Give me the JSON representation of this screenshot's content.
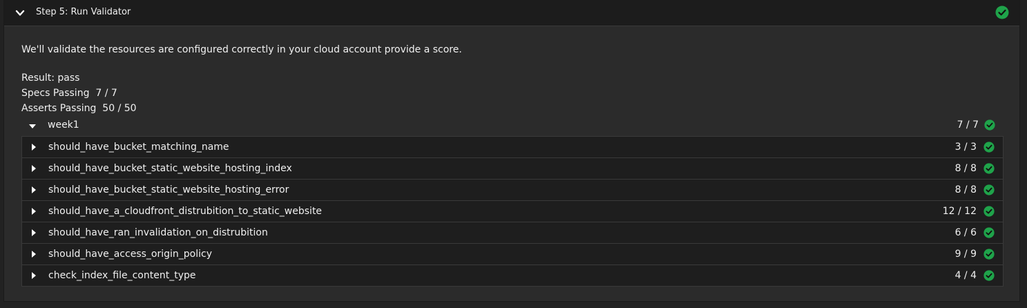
{
  "step": {
    "title": "Step 5: Run Validator",
    "status": "passed"
  },
  "description": "We'll validate the resources are configured correctly in your cloud account provide a score.",
  "summary": {
    "result": "Result: pass",
    "specs": "Specs Passing  7 / 7",
    "asserts": "Asserts Passing  50 / 50"
  },
  "group": {
    "name": "week1",
    "count": "7 / 7"
  },
  "specs": [
    {
      "name": "should_have_bucket_matching_name",
      "count": "3 / 3"
    },
    {
      "name": "should_have_bucket_static_website_hosting_index",
      "count": "8 / 8"
    },
    {
      "name": "should_have_bucket_static_website_hosting_error",
      "count": "8 / 8"
    },
    {
      "name": "should_have_a_cloudfront_distrubition_to_static_website",
      "count": "12 / 12"
    },
    {
      "name": "should_have_ran_invalidation_on_distrubition",
      "count": "6 / 6"
    },
    {
      "name": "should_have_access_origin_policy",
      "count": "9 / 9"
    },
    {
      "name": "check_index_file_content_type",
      "count": "4 / 4"
    }
  ],
  "colors": {
    "success": "#1fa34a",
    "background": "#2b2b2b",
    "header": "#1c1c1c"
  }
}
